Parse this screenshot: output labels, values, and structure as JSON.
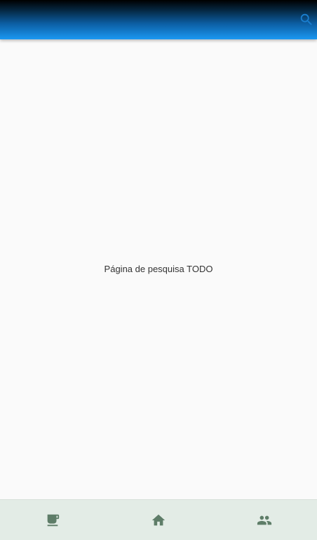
{
  "app_bar": {
    "search_icon": "search-icon",
    "icon_color": "#1a7fd0"
  },
  "main": {
    "placeholder_text": "Página de pesquisa TODO"
  },
  "bottom_nav": {
    "items": [
      {
        "icon": "coffee-cup-icon"
      },
      {
        "icon": "home-icon"
      },
      {
        "icon": "people-icon"
      }
    ],
    "icon_color": "#5e7d68",
    "background": "#e3ece6"
  }
}
